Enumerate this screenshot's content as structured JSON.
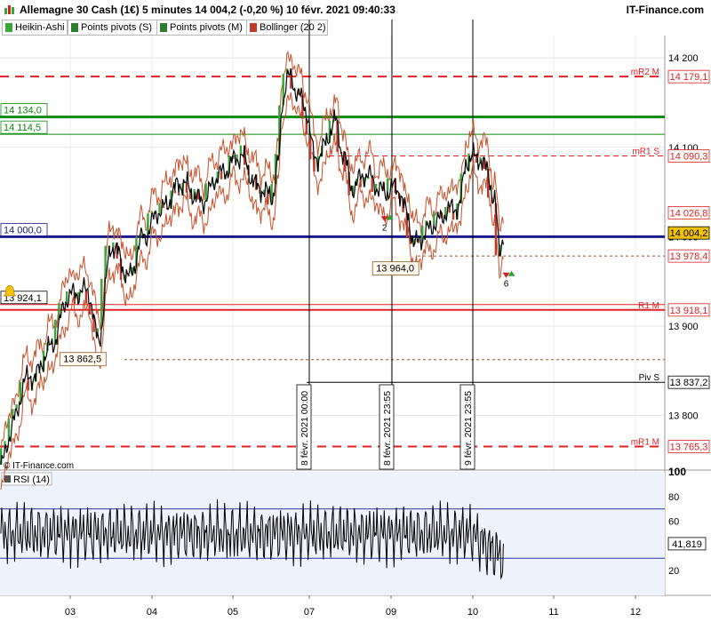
{
  "header": {
    "title": "Allemagne 30 Cash (1€) 5 minutes 14 004,2 (-0,20 %) 10 févr. 2021 09:40:33",
    "site": "IT-Finance.com"
  },
  "legend": [
    {
      "label": "Heikin-Ashi",
      "color": "#3aa63a"
    },
    {
      "label": "Points pivots (S)",
      "color": "#2f7d2f"
    },
    {
      "label": "Points pivots (M)",
      "color": "#2f7d2f"
    },
    {
      "label": "Bollinger (20 2)",
      "color": "#c0392b"
    }
  ],
  "watermark": "© IT-Finance.com",
  "colors": {
    "plot_bg": "#ffffff",
    "pivot_red": "#e02020",
    "pivot_green": "#0a8a0a",
    "navy": "#1a1a8c",
    "candle_up": "#3aa63a",
    "bollinger": "#c8502a",
    "price_line": "#000000",
    "rsi_bg": "#eef2fb",
    "rsi_line": "#000000"
  },
  "chart_data": [
    {
      "type": "line",
      "title": "Allemagne 30 Cash (1€) 5 minutes",
      "ylim": [
        13740,
        14225
      ],
      "y_ticks": [
        13800,
        13900,
        14000,
        14100,
        14200
      ],
      "x_ticks": [
        "03",
        "04",
        "05",
        "07",
        "09",
        "10",
        "11",
        "12"
      ],
      "series": [
        {
          "name": "Heikin-Ashi",
          "type": "line",
          "anchors": [
            [
              0.0,
              13745
            ],
            [
              0.2,
              13795
            ],
            [
              0.35,
              13840
            ],
            [
              0.5,
              13845
            ],
            [
              0.7,
              13875
            ],
            [
              1.0,
              13935
            ],
            [
              1.25,
              13940
            ],
            [
              1.4,
              13885
            ],
            [
              1.6,
              13990
            ],
            [
              1.85,
              13955
            ],
            [
              2.05,
              14000
            ],
            [
              2.3,
              14030
            ],
            [
              2.6,
              14060
            ],
            [
              2.9,
              14040
            ],
            [
              3.15,
              14070
            ],
            [
              3.45,
              14090
            ],
            [
              3.7,
              14055
            ],
            [
              3.9,
              14045
            ],
            [
              4.0,
              14085
            ],
            [
              4.05,
              14150
            ],
            [
              4.12,
              14180
            ],
            [
              4.25,
              14165
            ],
            [
              4.4,
              14140
            ],
            [
              4.52,
              14085
            ],
            [
              4.65,
              14100
            ],
            [
              4.8,
              14130
            ],
            [
              4.92,
              14095
            ],
            [
              5.05,
              14055
            ],
            [
              5.25,
              14070
            ],
            [
              5.5,
              14050
            ],
            [
              5.7,
              14055
            ],
            [
              5.85,
              14025
            ],
            [
              5.95,
              13990
            ],
            [
              6.05,
              14000
            ],
            [
              6.25,
              14015
            ],
            [
              6.45,
              14030
            ],
            [
              6.6,
              14035
            ],
            [
              6.7,
              14085
            ],
            [
              6.85,
              14090
            ],
            [
              7.0,
              14075
            ],
            [
              7.1,
              14040
            ],
            [
              7.18,
              13985
            ],
            [
              7.23,
              14004
            ]
          ],
          "bollinger_width": 14
        },
        {
          "name": "Points pivots (S)",
          "levels": [
            {
              "label": "mR2 M",
              "value": 14179.1,
              "style": "dash-red"
            },
            {
              "label": "",
              "value": 14134.0,
              "style": "solid-green"
            },
            {
              "label": "",
              "value": 14114.5,
              "style": "thin-green"
            },
            {
              "label": "mR1 S",
              "value": 14090.3,
              "style": "dash-red-thin"
            },
            {
              "label": "",
              "value": 14026.8,
              "style": "none"
            },
            {
              "label": "",
              "value": 14000.0,
              "style": "solid-navy"
            },
            {
              "label": "",
              "value": 13978.4,
              "style": "dash-brown"
            },
            {
              "label": "",
              "value": 13924.1,
              "style": "thin-red"
            },
            {
              "label": "R1 M",
              "value": 13918.1,
              "style": "solid-red"
            },
            {
              "label": "",
              "value": 13862.5,
              "style": "dash-brown-thin"
            },
            {
              "label": "Piv S",
              "value": 13837.2,
              "style": "solid-black"
            },
            {
              "label": "mR1 M",
              "value": 13765.3,
              "style": "dash-red"
            }
          ]
        }
      ],
      "price_labels": [
        {
          "text": "14 179,1",
          "value": 14179.1,
          "color": "#e02020",
          "fill": "#ffffff"
        },
        {
          "text": "14 090,3",
          "value": 14090.3,
          "color": "#e02020",
          "fill": "#ffffff"
        },
        {
          "text": "14 026,8",
          "value": 14026.8,
          "color": "#e02020",
          "fill": "#ffffff"
        },
        {
          "text": "14 004,2",
          "value": 14004.2,
          "color": "#000000",
          "fill": "#f2c200"
        },
        {
          "text": "13 978,4",
          "value": 13978.4,
          "color": "#e02020",
          "fill": "#ffffff"
        },
        {
          "text": "13 918,1",
          "value": 13918.1,
          "color": "#e02020",
          "fill": "#ffffff"
        },
        {
          "text": "13 837,2",
          "value": 13837.2,
          "color": "#000000",
          "fill": "#ffffff"
        },
        {
          "text": "13 765,3",
          "value": 13765.3,
          "color": "#e02020",
          "fill": "#ffffff"
        }
      ],
      "left_labels": [
        {
          "text": "14 134,0",
          "value": 14134.0,
          "color": "#0a8a0a"
        },
        {
          "text": "14 114,5",
          "value": 14114.5,
          "color": "#0a8a0a"
        },
        {
          "text": "14 000,0",
          "value": 14000.0,
          "color": "#1a1a8c"
        },
        {
          "text": "13 924,1",
          "value": 13924.1,
          "color": "#000000"
        }
      ],
      "annotations": [
        {
          "text": "13 862,5",
          "x": 0.95,
          "value": 13862.5
        },
        {
          "text": "13 964,0",
          "x": 5.45,
          "value": 13964.0
        }
      ],
      "markers": [
        {
          "text": "2",
          "x": 5.52,
          "value": 14015
        },
        {
          "text": "6",
          "x": 7.27,
          "value": 13952
        }
      ],
      "session_lines": [
        {
          "text": "8 févr. 2021 00:00",
          "x": 3.94
        },
        {
          "text": "8 févr. 2021 23:55",
          "x": 4.92
        },
        {
          "text": "9 févr. 2021 23:55",
          "x": 5.9
        }
      ]
    },
    {
      "type": "line",
      "title": "RSI (14)",
      "ylim": [
        0,
        100
      ],
      "y_ticks": [
        20,
        40,
        60,
        80,
        100
      ],
      "current_value": "41,819",
      "bands": [
        30,
        70
      ],
      "series": [
        {
          "name": "RSI (14)",
          "mean": 50,
          "last": 41.8
        }
      ]
    }
  ]
}
